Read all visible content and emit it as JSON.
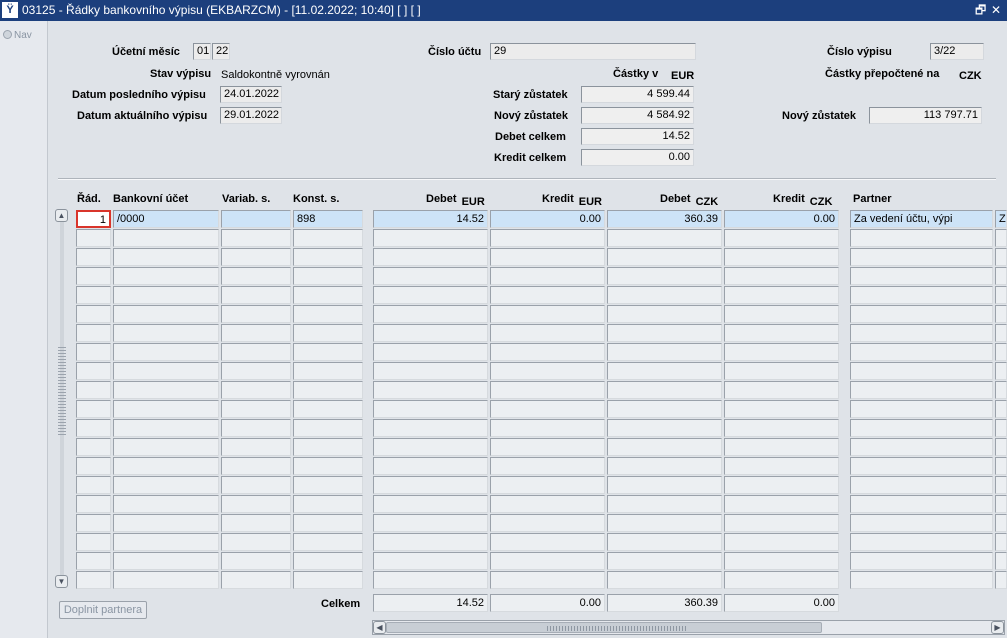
{
  "window": {
    "title": "03125 - Řádky bankovního výpisu (EKBARZCM) - [11.02.2022; 10:40]  [ ]  [ ]",
    "restore_glyph": "🗗",
    "close_glyph": "✕",
    "app_icon_glyph": "Ϋ"
  },
  "nav": {
    "label": "Nav"
  },
  "header": {
    "ucetni_mesic_label": "Účetní měsíc",
    "ucetni_mesic_month": "01",
    "ucetni_mesic_year": "22",
    "stav_vypisu_label": "Stav výpisu",
    "stav_vypisu_value": "Saldokontně vyrovnán",
    "datum_posledniho_label": "Datum posledního výpisu",
    "datum_posledniho_value": "24.01.2022",
    "datum_aktualniho_label": "Datum aktuálního výpisu",
    "datum_aktualniho_value": "29.01.2022",
    "cislo_uctu_label": "Číslo účtu",
    "cislo_uctu_value": "29",
    "castky_v_label": "Částky v",
    "castky_v_currency": "EUR",
    "stary_zustatek_label": "Starý zůstatek",
    "stary_zustatek_value": "4 599.44",
    "novy_zustatek_label": "Nový zůstatek",
    "novy_zustatek_value": "4 584.92",
    "debet_celkem_label": "Debet celkem",
    "debet_celkem_value": "14.52",
    "kredit_celkem_label": "Kredit celkem",
    "kredit_celkem_value": "0.00",
    "cislo_vypisu_label": "Číslo výpisu",
    "cislo_vypisu_value": "3/22",
    "castky_prepoctene_label": "Částky  přepočtené na",
    "castky_prepoctene_currency": "CZK",
    "novy_zustatek_czk_label": "Nový zůstatek",
    "novy_zustatek_czk_value": "113 797.71"
  },
  "table": {
    "columns": {
      "rad": "Řád.",
      "bankovni_ucet": "Bankovní účet",
      "variab": "Variab. s.",
      "konst": "Konst. s.",
      "debet_eur": "Debet",
      "debet_eur_cur": "EUR",
      "kredit_eur": "Kredit",
      "kredit_eur_cur": "EUR",
      "debet_czk": "Debet",
      "debet_czk_cur": "CZK",
      "kredit_czk": "Kredit",
      "kredit_czk_cur": "CZK",
      "partner": "Partner"
    },
    "rows": [
      {
        "rad": "1",
        "bankovni_ucet": "/0000",
        "variab": "",
        "konst": "898",
        "debet_eur": "14.52",
        "kredit_eur": "0.00",
        "debet_czk": "360.39",
        "kredit_czk": "0.00",
        "partner": "Za vedení účtu, výpi",
        "extra": "Z"
      }
    ],
    "empty_row_count": 19,
    "totals": {
      "label": "Celkem",
      "debet_eur": "14.52",
      "kredit_eur": "0.00",
      "debet_czk": "360.39",
      "kredit_czk": "0.00"
    }
  },
  "buttons": {
    "doplnit_partnera": "Doplnit partnera"
  },
  "scroll": {
    "up_glyph": "▲",
    "down_glyph": "▼",
    "left_glyph": "◀",
    "right_glyph": "▶"
  }
}
